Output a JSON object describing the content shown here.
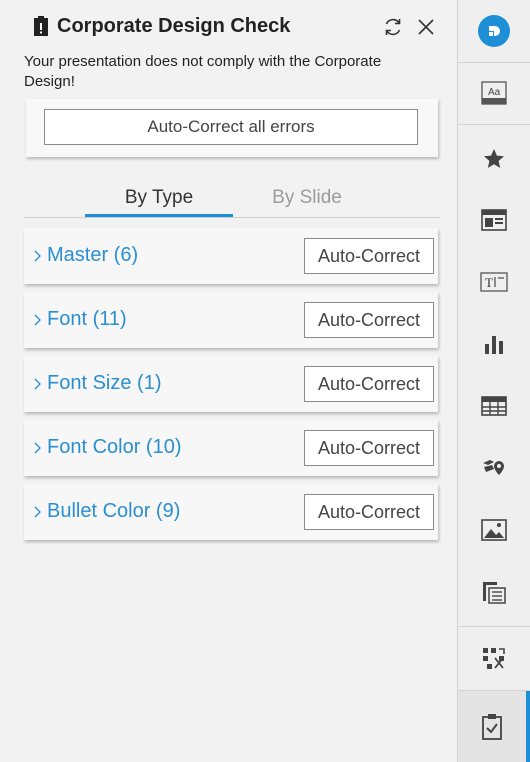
{
  "header": {
    "title": "Corporate Design Check"
  },
  "message": "Your presentation does not comply with the Corporate Design!",
  "auto_correct_all_label": "Auto-Correct all errors",
  "tabs": [
    {
      "label": "By Type",
      "active": true
    },
    {
      "label": "By Slide",
      "active": false
    }
  ],
  "categories": [
    {
      "label": "Master (6)",
      "button": "Auto-Correct"
    },
    {
      "label": "Font (11)",
      "button": "Auto-Correct"
    },
    {
      "label": "Font Size (1)",
      "button": "Auto-Correct"
    },
    {
      "label": "Font Color (10)",
      "button": "Auto-Correct"
    },
    {
      "label": "Bullet Color (9)",
      "button": "Auto-Correct"
    }
  ],
  "toolbar": {
    "items": [
      {
        "icon": "logo-icon"
      },
      {
        "icon": "font-styles-icon"
      },
      {
        "icon": "star-icon"
      },
      {
        "icon": "layout-icon"
      },
      {
        "icon": "text-box-icon"
      },
      {
        "icon": "bar-chart-icon"
      },
      {
        "icon": "table-icon"
      },
      {
        "icon": "map-pin-icon"
      },
      {
        "icon": "image-icon"
      },
      {
        "icon": "agenda-icon"
      },
      {
        "icon": "shuffle-grid-icon"
      },
      {
        "icon": "clipboard-check-icon",
        "active": true
      }
    ]
  },
  "colors": {
    "accent": "#1e8fd6",
    "link": "#2a8fd0",
    "background": "#f2f2f2"
  }
}
